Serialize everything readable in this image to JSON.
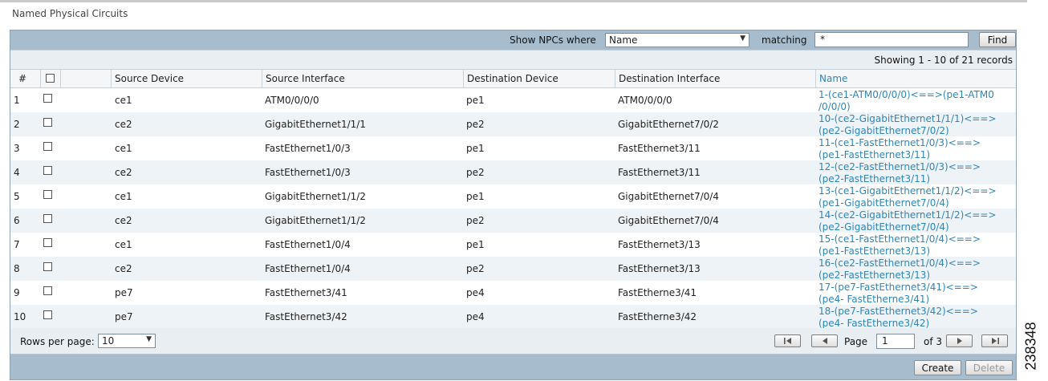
{
  "page": {
    "title": "Named Physical Circuits"
  },
  "filter": {
    "show_label": "Show NPCs where",
    "field_value": "Name",
    "matching_label": "matching",
    "match_value": "*",
    "find_label": "Find"
  },
  "records_text": "Showing 1 - 10 of 21 records",
  "table": {
    "headers": {
      "num": "#",
      "source_device": "Source Device",
      "source_interface": "Source Interface",
      "destination_device": "Destination Device",
      "destination_interface": "Destination Interface",
      "name": "Name"
    },
    "rows": [
      {
        "num": "1",
        "src_dev": "ce1",
        "src_if": "ATM0/0/0/0",
        "dst_dev": "pe1",
        "dst_if": "ATM0/0/0/0",
        "name": "1-(ce1-ATM0/0/0/0)<==>(pe1-ATM0 /0/0/0)"
      },
      {
        "num": "2",
        "src_dev": "ce2",
        "src_if": "GigabitEthernet1/1/1",
        "dst_dev": "pe2",
        "dst_if": "GigabitEthernet7/0/2",
        "name": "10-(ce2-GigabitEthernet1/1/1)<==> (pe2-GigabitEthernet7/0/2)"
      },
      {
        "num": "3",
        "src_dev": "ce1",
        "src_if": "FastEthernet1/0/3",
        "dst_dev": "pe1",
        "dst_if": "FastEthernet3/11",
        "name": "11-(ce1-FastEthernet1/0/3)<==> (pe1-FastEthernet3/11)"
      },
      {
        "num": "4",
        "src_dev": "ce2",
        "src_if": "FastEthernet1/0/3",
        "dst_dev": "pe2",
        "dst_if": "FastEthernet3/11",
        "name": "12-(ce2-FastEthernet1/0/3)<==> (pe2-FastEthernet3/11)"
      },
      {
        "num": "5",
        "src_dev": "ce1",
        "src_if": "GigabitEthernet1/1/2",
        "dst_dev": "pe1",
        "dst_if": "GigabitEthernet7/0/4",
        "name": "13-(ce1-GigabitEthernet1/1/2)<==> (pe1-GigabitEthernet7/0/4)"
      },
      {
        "num": "6",
        "src_dev": "ce2",
        "src_if": "GigabitEthernet1/1/2",
        "dst_dev": "pe2",
        "dst_if": "GigabitEthernet7/0/4",
        "name": "14-(ce2-GigabitEthernet1/1/2)<==> (pe2-GigabitEthernet7/0/4)"
      },
      {
        "num": "7",
        "src_dev": "ce1",
        "src_if": "FastEthernet1/0/4",
        "dst_dev": "pe1",
        "dst_if": "FastEthernet3/13",
        "name": "15-(ce1-FastEthernet1/0/4)<==> (pe1-FastEthernet3/13)"
      },
      {
        "num": "8",
        "src_dev": "ce2",
        "src_if": "FastEthernet1/0/4",
        "dst_dev": "pe2",
        "dst_if": "FastEthernet3/13",
        "name": "16-(ce2-FastEthernet1/0/4)<==> (pe2-FastEthernet3/13)"
      },
      {
        "num": "9",
        "src_dev": "pe7",
        "src_if": "FastEthernet3/41",
        "dst_dev": "pe4",
        "dst_if": "FastEtherne3/41",
        "name": "17-(pe7-FastEthernet3/41)<==>(pe4- FastEtherne3/41)"
      },
      {
        "num": "10",
        "src_dev": "pe7",
        "src_if": "FastEthernet3/42",
        "dst_dev": "pe4",
        "dst_if": "FastEtherne3/42",
        "name": "18-(pe7-FastEthernet3/42)<==>(pe4- FastEtherne3/42)"
      }
    ]
  },
  "pagination": {
    "rows_per_page_label": "Rows per page:",
    "rows_per_page_value": "10",
    "page_label": "Page",
    "page_value": "1",
    "of_label": "of 3"
  },
  "actions": {
    "create_label": "Create",
    "delete_label": "Delete"
  },
  "side_code": "238348",
  "icons": {
    "first": "first-page-icon",
    "prev": "previous-page-icon",
    "next": "next-page-icon",
    "last": "last-page-icon",
    "dropdown": "chevron-down-icon"
  },
  "colors": {
    "panel": "#a7bdcd",
    "link": "#2e86b8",
    "row_alt": "#eef3f7"
  }
}
